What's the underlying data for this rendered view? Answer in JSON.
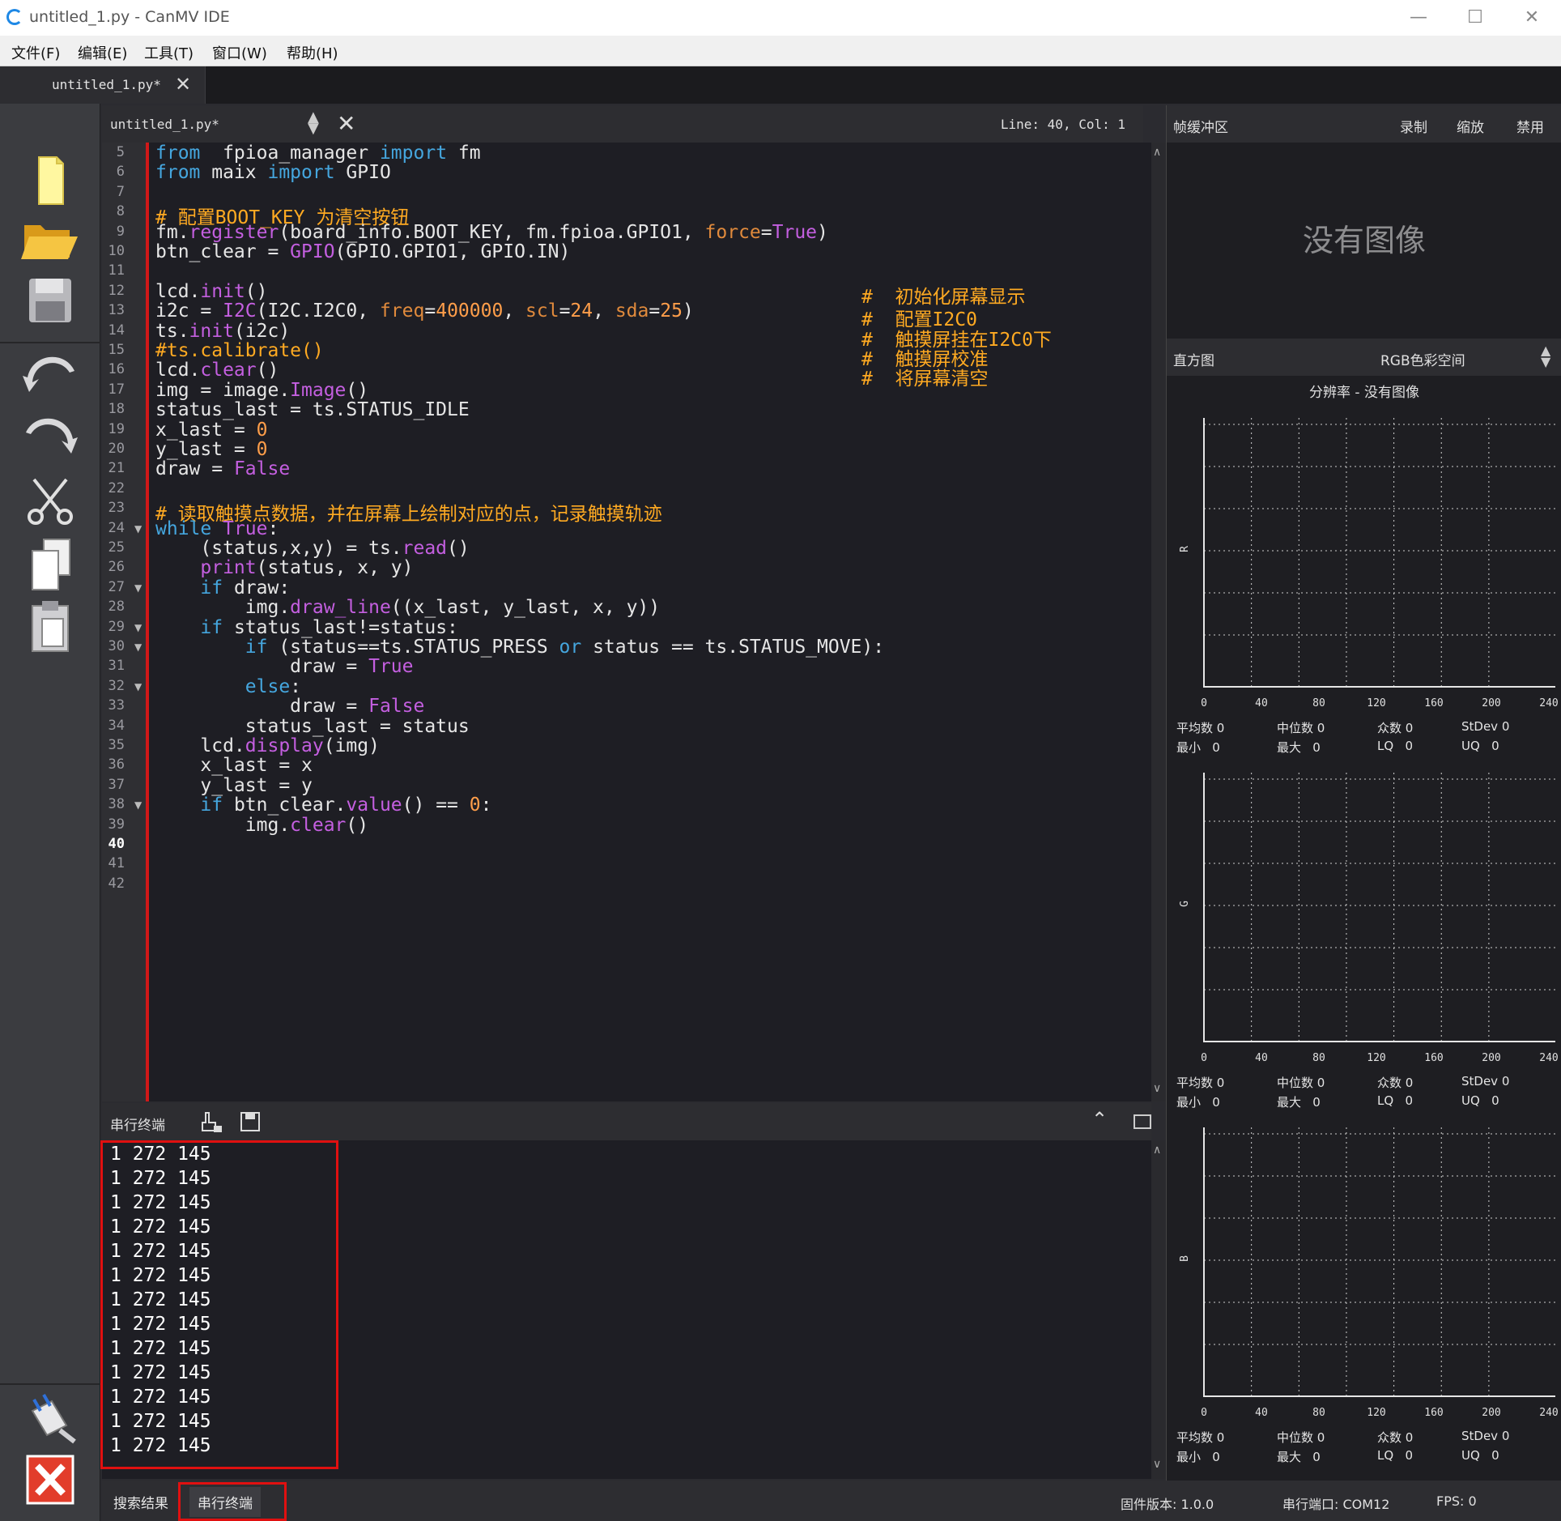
{
  "window": {
    "title": "untitled_1.py - CanMV IDE"
  },
  "menu": [
    "文件(F)",
    "编辑(E)",
    "工具(T)",
    "窗口(W)",
    "帮助(H)"
  ],
  "tab": {
    "label": "untitled_1.py*"
  },
  "editor": {
    "filename": "untitled_1.py*",
    "cursor": "Line: 40, Col: 1",
    "lines": [
      {
        "n": "5",
        "fold": false,
        "parts": [
          [
            "kw",
            "from"
          ],
          [
            "",
            "  fpioa_manager "
          ],
          [
            "kw",
            "import"
          ],
          [
            "",
            " fm"
          ]
        ]
      },
      {
        "n": "6",
        "fold": false,
        "parts": [
          [
            "kw",
            "from"
          ],
          [
            "",
            " maix "
          ],
          [
            "kw",
            "import"
          ],
          [
            "",
            " GPIO"
          ]
        ]
      },
      {
        "n": "7",
        "fold": false,
        "parts": []
      },
      {
        "n": "8",
        "fold": false,
        "parts": [
          [
            "cm",
            "# 配置BOOT_KEY 为清空按钮"
          ]
        ]
      },
      {
        "n": "9",
        "fold": false,
        "parts": [
          [
            "",
            "fm."
          ],
          [
            "fn",
            "register"
          ],
          [
            "",
            "(board_info.BOOT_KEY, fm.fpioa.GPIO1, "
          ],
          [
            "pr",
            "force"
          ],
          [
            "",
            "="
          ],
          [
            "tv",
            "True"
          ],
          [
            "",
            ")"
          ]
        ]
      },
      {
        "n": "10",
        "fold": false,
        "parts": [
          [
            "",
            "btn_clear = "
          ],
          [
            "fn",
            "GPIO"
          ],
          [
            "",
            "(GPIO.GPIO1, GPIO.IN)"
          ]
        ]
      },
      {
        "n": "11",
        "fold": false,
        "parts": []
      },
      {
        "n": "12",
        "fold": false,
        "parts": [
          [
            "",
            "lcd."
          ],
          [
            "fn",
            "init"
          ],
          [
            "",
            "()"
          ]
        ]
      },
      {
        "n": "13",
        "fold": false,
        "parts": [
          [
            "",
            "i2c = "
          ],
          [
            "fn",
            "I2C"
          ],
          [
            "",
            "(I2C.I2C0, "
          ],
          [
            "pr",
            "freq"
          ],
          [
            "",
            "="
          ],
          [
            "nm",
            "400000"
          ],
          [
            "",
            ", "
          ],
          [
            "pr",
            "scl"
          ],
          [
            "",
            "="
          ],
          [
            "nm",
            "24"
          ],
          [
            "",
            ", "
          ],
          [
            "pr",
            "sda"
          ],
          [
            "",
            "="
          ],
          [
            "nm",
            "25"
          ],
          [
            "",
            ")"
          ]
        ]
      },
      {
        "n": "14",
        "fold": false,
        "parts": [
          [
            "",
            "ts."
          ],
          [
            "fn",
            "init"
          ],
          [
            "",
            "(i2c)"
          ]
        ]
      },
      {
        "n": "15",
        "fold": false,
        "parts": [
          [
            "cm",
            "#ts.calibrate()"
          ]
        ]
      },
      {
        "n": "16",
        "fold": false,
        "parts": [
          [
            "",
            "lcd."
          ],
          [
            "fn",
            "clear"
          ],
          [
            "",
            "()"
          ]
        ]
      },
      {
        "n": "17",
        "fold": false,
        "parts": [
          [
            "",
            "img = image."
          ],
          [
            "fn",
            "Image"
          ],
          [
            "",
            "()"
          ]
        ]
      },
      {
        "n": "18",
        "fold": false,
        "parts": [
          [
            "",
            "status_last = ts.STATUS_IDLE"
          ]
        ]
      },
      {
        "n": "19",
        "fold": false,
        "parts": [
          [
            "",
            "x_last = "
          ],
          [
            "nm",
            "0"
          ]
        ]
      },
      {
        "n": "20",
        "fold": false,
        "parts": [
          [
            "",
            "y_last = "
          ],
          [
            "nm",
            "0"
          ]
        ]
      },
      {
        "n": "21",
        "fold": false,
        "parts": [
          [
            "",
            "draw = "
          ],
          [
            "tv",
            "False"
          ]
        ]
      },
      {
        "n": "22",
        "fold": false,
        "parts": []
      },
      {
        "n": "23",
        "fold": false,
        "parts": [
          [
            "cm",
            "# 读取触摸点数据，并在屏幕上绘制对应的点，记录触摸轨迹"
          ]
        ]
      },
      {
        "n": "24",
        "fold": true,
        "parts": [
          [
            "kw",
            "while"
          ],
          [
            "",
            " "
          ],
          [
            "tv",
            "True"
          ],
          [
            "",
            ":"
          ]
        ]
      },
      {
        "n": "25",
        "fold": false,
        "parts": [
          [
            "",
            "    (status,x,y) = ts."
          ],
          [
            "fn",
            "read"
          ],
          [
            "",
            "()"
          ]
        ]
      },
      {
        "n": "26",
        "fold": false,
        "parts": [
          [
            "",
            "    "
          ],
          [
            "fn",
            "print"
          ],
          [
            "",
            "(status, x, y)"
          ]
        ]
      },
      {
        "n": "27",
        "fold": true,
        "parts": [
          [
            "",
            "    "
          ],
          [
            "kw",
            "if"
          ],
          [
            "",
            " draw:"
          ]
        ]
      },
      {
        "n": "28",
        "fold": false,
        "parts": [
          [
            "",
            "        img."
          ],
          [
            "fn",
            "draw_line"
          ],
          [
            "",
            "((x_last, y_last, x, y))"
          ]
        ]
      },
      {
        "n": "29",
        "fold": true,
        "parts": [
          [
            "",
            "    "
          ],
          [
            "kw",
            "if"
          ],
          [
            "",
            " status_last!=status:"
          ]
        ]
      },
      {
        "n": "30",
        "fold": true,
        "parts": [
          [
            "",
            "        "
          ],
          [
            "kw",
            "if"
          ],
          [
            "",
            " (status==ts.STATUS_PRESS "
          ],
          [
            "kw",
            "or"
          ],
          [
            "",
            " status == ts.STATUS_MOVE):"
          ]
        ]
      },
      {
        "n": "31",
        "fold": false,
        "parts": [
          [
            "",
            "            draw = "
          ],
          [
            "tv",
            "True"
          ]
        ]
      },
      {
        "n": "32",
        "fold": true,
        "parts": [
          [
            "",
            "        "
          ],
          [
            "kw",
            "else"
          ],
          [
            "",
            ":"
          ]
        ]
      },
      {
        "n": "33",
        "fold": false,
        "parts": [
          [
            "",
            "            draw = "
          ],
          [
            "tv",
            "False"
          ]
        ]
      },
      {
        "n": "34",
        "fold": false,
        "parts": [
          [
            "",
            "        status_last = status"
          ]
        ]
      },
      {
        "n": "35",
        "fold": false,
        "parts": [
          [
            "",
            "    lcd."
          ],
          [
            "fn",
            "display"
          ],
          [
            "",
            "(img)"
          ]
        ]
      },
      {
        "n": "36",
        "fold": false,
        "parts": [
          [
            "",
            "    x_last = x"
          ]
        ]
      },
      {
        "n": "37",
        "fold": false,
        "parts": [
          [
            "",
            "    y_last = y"
          ]
        ]
      },
      {
        "n": "38",
        "fold": true,
        "parts": [
          [
            "",
            "    "
          ],
          [
            "kw",
            "if"
          ],
          [
            "",
            " btn_clear."
          ],
          [
            "fn",
            "value"
          ],
          [
            "",
            "() == "
          ],
          [
            "nm",
            "0"
          ],
          [
            "",
            ":"
          ]
        ]
      },
      {
        "n": "39",
        "fold": false,
        "parts": [
          [
            "",
            "        img."
          ],
          [
            "fn",
            "clear"
          ],
          [
            "",
            "()"
          ]
        ]
      },
      {
        "n": "40",
        "fold": false,
        "parts": []
      },
      {
        "n": "41",
        "fold": false,
        "parts": []
      },
      {
        "n": "42",
        "fold": false,
        "parts": []
      }
    ],
    "comments": [
      {
        "row": 7,
        "text": "#  初始化屏幕显示"
      },
      {
        "row": 8,
        "text": "#  配置I2C0"
      },
      {
        "row": 9,
        "text": "#  触摸屏挂在I2C0下"
      },
      {
        "row": 10,
        "text": "#  触摸屏校准"
      },
      {
        "row": 11,
        "text": "#  将屏幕清空"
      }
    ]
  },
  "terminal": {
    "label": "串行终端",
    "lines": [
      "1 272 145",
      "1 272 145",
      "1 272 145",
      "1 272 145",
      "1 272 145",
      "1 272 145",
      "1 272 145",
      "1 272 145",
      "1 272 145",
      "1 272 145",
      "1 272 145",
      "1 272 145",
      "1 272 145"
    ]
  },
  "statusbar": {
    "tab_search": "搜索结果",
    "tab_serial": "串行终端",
    "firmware": "固件版本: 1.0.0",
    "port": "串行端口: COM12",
    "fps": "FPS: 0"
  },
  "framebuffer": {
    "label": "帧缓冲区",
    "record": "录制",
    "zoom": "缩放",
    "disable": "禁用",
    "no_image": "没有图像"
  },
  "histogram": {
    "label": "直方图",
    "colorspace": "RGB色彩空间",
    "resolution": "分辨率 - 没有图像",
    "xticks": [
      "0",
      "40",
      "80",
      "120",
      "160",
      "200",
      "240"
    ],
    "channels": [
      {
        "name": "R",
        "stats": {
          "mean": "平均数 0",
          "median": "中位数 0",
          "mode": "众数 0",
          "stdev": "StDev 0",
          "min": "最小   0",
          "max": "最大   0",
          "lq": "LQ   0",
          "uq": "UQ   0"
        }
      },
      {
        "name": "G",
        "stats": {
          "mean": "平均数 0",
          "median": "中位数 0",
          "mode": "众数 0",
          "stdev": "StDev 0",
          "min": "最小   0",
          "max": "最大   0",
          "lq": "LQ   0",
          "uq": "UQ   0"
        }
      },
      {
        "name": "B",
        "stats": {
          "mean": "平均数 0",
          "median": "中位数 0",
          "mode": "众数 0",
          "stdev": "StDev 0",
          "min": "最小   0",
          "max": "最大   0",
          "lq": "LQ   0",
          "uq": "UQ   0"
        }
      }
    ]
  }
}
